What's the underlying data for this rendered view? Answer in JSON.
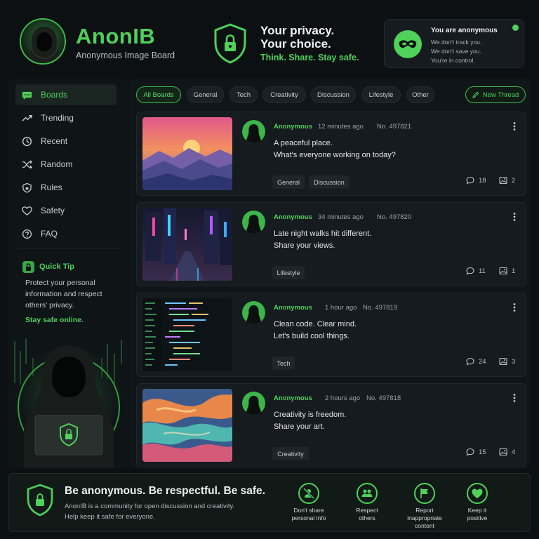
{
  "brand": {
    "name": "AnonIB",
    "subtitle": "Anonymous Image Board"
  },
  "privacy": {
    "line1": "Your privacy.",
    "line2": "Your choice.",
    "line3": "Think. Share. Stay safe."
  },
  "anon_card": {
    "title": "You are anonymous",
    "lines": [
      "We don't track you.",
      "We don't save you.",
      "You're in control."
    ],
    "status_color": "#4fd15a"
  },
  "sidebar": {
    "items": [
      {
        "label": "Boards",
        "icon": "chat-bubble-icon",
        "active": true
      },
      {
        "label": "Trending",
        "icon": "trending-icon"
      },
      {
        "label": "Recent",
        "icon": "clock-icon"
      },
      {
        "label": "Random",
        "icon": "shuffle-icon"
      },
      {
        "label": "Rules",
        "icon": "shield-icon"
      },
      {
        "label": "Safety",
        "icon": "heart-icon"
      },
      {
        "label": "FAQ",
        "icon": "question-icon"
      }
    ],
    "tip": {
      "title": "Quick Tip",
      "lines": [
        "Protect your personal",
        "information and respect",
        "others' privacy."
      ],
      "stay": "Stay safe online."
    }
  },
  "filters": {
    "chips": [
      "All Boards",
      "General",
      "Tech",
      "Creativity",
      "Discussion",
      "Lifestyle",
      "Other"
    ],
    "active": "All Boards",
    "new_thread": "New Thread"
  },
  "posts": [
    {
      "author": "Anonymous",
      "time": "12 minutes ago",
      "number": "No. 497821",
      "line1": "A peaceful place.",
      "line2": "What's everyone working on today?",
      "tags": [
        "General",
        "Discussion"
      ],
      "replies": "18",
      "images": "2",
      "thumbnail": "sunset-mountains"
    },
    {
      "author": "Anonymous",
      "time": "34 minutes ago",
      "number": "No. 497820",
      "line1": "Late night walks hit different.",
      "line2": "Share your views.",
      "tags": [
        "Lifestyle"
      ],
      "replies": "11",
      "images": "1",
      "thumbnail": "neon-city-street"
    },
    {
      "author": "Anonymous",
      "time": "1 hour ago",
      "number": "No. 497819",
      "line1": "Clean code. Clear mind.",
      "line2": "Let's build cool things.",
      "tags": [
        "Tech"
      ],
      "replies": "24",
      "images": "3",
      "thumbnail": "code-editor"
    },
    {
      "author": "Anonymous",
      "time": "2 hours ago",
      "number": "No. 497818",
      "line1": "Creativity is freedom.",
      "line2": "Share your art.",
      "tags": [
        "Creativity"
      ],
      "replies": "15",
      "images": "4",
      "thumbnail": "abstract-paint"
    }
  ],
  "footer": {
    "title": "Be anonymous. Be respectful. Be safe.",
    "text1": "AnonIB is a community for open discussion and creativity.",
    "text2": "Help keep it safe for everyone.",
    "rules": [
      {
        "lines": [
          "Don't share",
          "personal info"
        ],
        "icon": "no-user-icon"
      },
      {
        "lines": [
          "Respect",
          "others"
        ],
        "icon": "people-icon"
      },
      {
        "lines": [
          "Report",
          "inappropriate",
          "content"
        ],
        "icon": "flag-icon"
      },
      {
        "lines": [
          "Keep it",
          "positive"
        ],
        "icon": "heart-icon"
      }
    ]
  },
  "colors": {
    "accent": "#4fd15a",
    "background": "#0c1013",
    "card": "#151b1f"
  }
}
